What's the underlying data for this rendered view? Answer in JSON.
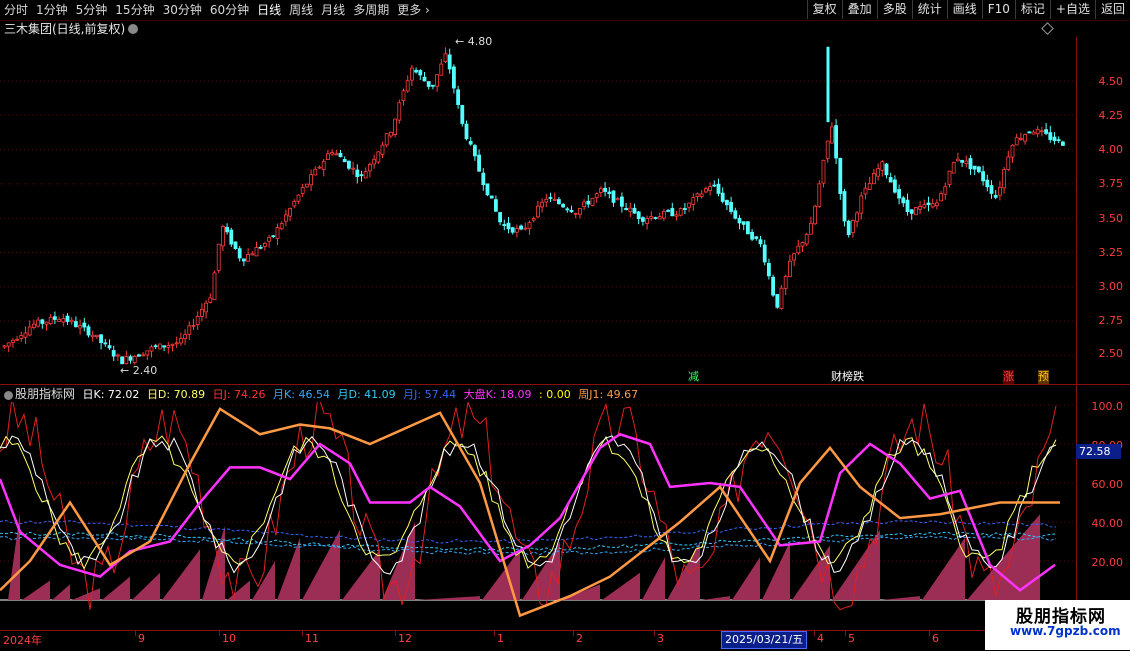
{
  "toolbar": {
    "tabs": [
      "分时",
      "1分钟",
      "5分钟",
      "15分钟",
      "30分钟",
      "60分钟",
      "日线",
      "周线",
      "月线",
      "多周期",
      "更多"
    ],
    "active_tab": "日线",
    "right_buttons": [
      "复权",
      "叠加",
      "多股",
      "统计",
      "画线",
      "F10",
      "标记",
      "+自选",
      "返回"
    ]
  },
  "title": "三木集团(日线,前复权)",
  "price_axis": [
    "4.50",
    "4.25",
    "4.00",
    "3.75",
    "3.50",
    "3.25",
    "3.00",
    "2.75",
    "2.50"
  ],
  "price_annotations": {
    "high": "4.80",
    "low": "2.40"
  },
  "markers": [
    {
      "text": "减",
      "color": "#33ff66"
    },
    {
      "text": "财榜跌",
      "color": "#ffffff"
    },
    {
      "text": "涨",
      "color": "#ff4444"
    },
    {
      "text": "预",
      "color": "#ffcc00"
    }
  ],
  "indicator": {
    "name": "股朋指标网",
    "items": [
      {
        "label": "日K: 72.02",
        "color": "#ffffff"
      },
      {
        "label": "日D: 70.89",
        "color": "#ffff66"
      },
      {
        "label": "日J: 74.26",
        "color": "#ff3333"
      },
      {
        "label": "月K: 46.54",
        "color": "#33aaff"
      },
      {
        "label": "月D: 41.09",
        "color": "#33ccff"
      },
      {
        "label": "月J: 57.44",
        "color": "#3366ff"
      },
      {
        "label": "大盘K: 18.09",
        "color": "#ff33ff"
      },
      {
        "label": ": 0.00",
        "color": "#ffff00"
      },
      {
        "label": "周J1: 49.67",
        "color": "#ff9944"
      }
    ],
    "axis": [
      "100.0",
      "80.00",
      "60.00",
      "40.00",
      "20.00"
    ],
    "current_value": "72.58"
  },
  "date_axis": {
    "labels": [
      "2024年",
      "9",
      "10",
      "11",
      "12",
      "1",
      "2",
      "3",
      "4",
      "5",
      "6"
    ],
    "highlight": "2025/03/21/五"
  },
  "watermark": {
    "title": "股朋指标网",
    "url": "www.7gpzb.com"
  },
  "colors": {
    "up": "#ff3c3c",
    "down": "#54ffff",
    "grid": "#8a1010"
  }
}
